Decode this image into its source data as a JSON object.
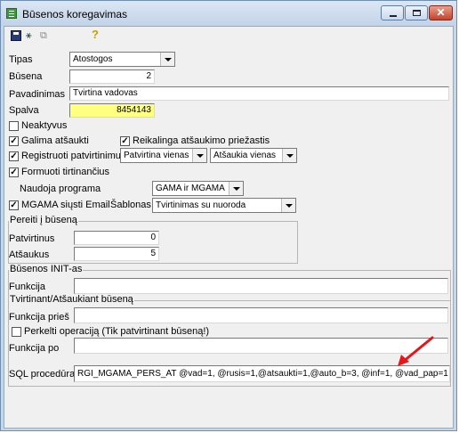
{
  "window": {
    "title": "Būsenos koregavimas",
    "app_icon": "form-icon",
    "accent": "#c7d6e8"
  },
  "toolbar": {
    "icons": [
      "save-icon",
      "tree-icon",
      "copy-icon",
      "help-icon"
    ],
    "tree_glyph": "⚹",
    "copy_glyph": "⧉",
    "help_glyph": "?"
  },
  "window_buttons": {
    "close_glyph": "✕"
  },
  "form": {
    "tipas": {
      "label": "Tipas",
      "value": "Atostogos"
    },
    "busena": {
      "label": "Būsena",
      "value": "2"
    },
    "pavadinimas": {
      "label": "Pavadinimas",
      "value": "Tvirtina vadovas"
    },
    "spalva": {
      "label": "Spalva",
      "value": "8454143",
      "color": "#ffff80"
    },
    "neaktyvus": {
      "label": "Neaktyvus",
      "checked": false
    },
    "galima_atsaukti": {
      "label": "Galima atšaukti",
      "checked": true
    },
    "reikalinga": {
      "label": "Reikalinga atšaukimo priežastis",
      "checked": true
    },
    "registruoti": {
      "label": "Registruoti patvirtinimus",
      "checked": true
    },
    "patvirtina": {
      "value": "Patvirtina vienas"
    },
    "atsaukia": {
      "value": "Atšaukia vienas"
    },
    "formuoti": {
      "label": "Formuoti tirtinančius",
      "checked": true
    },
    "naudoja": {
      "label": "Naudoja programa",
      "value": "GAMA ir MGAMA"
    },
    "mgama_email": {
      "label": "MGAMA siųsti Email",
      "checked": true
    },
    "sablonas": {
      "label": "Šablonas",
      "value": "Tvirtinimas su nuoroda"
    },
    "pereiti": {
      "title": "Pereiti į būseną",
      "patvirtinus": {
        "label": "Patvirtinus",
        "value": "0"
      },
      "atsaukus": {
        "label": "Atšaukus",
        "value": "5"
      }
    },
    "init": {
      "title": "Būsenos INIT-as",
      "funkcija": {
        "label": "Funkcija",
        "value": ""
      }
    },
    "tvirtinant": {
      "title": "Tvirtinant/Atšaukiant būseną",
      "funkcija_pries": {
        "label": "Funkcija prieš",
        "value": ""
      },
      "perkelti": {
        "label": "Perkelti operaciją (Tik patvirtinant būseną!)",
        "checked": false
      },
      "funkcija_po": {
        "label": "Funkcija po",
        "value": ""
      }
    },
    "sql": {
      "label": "SQL procedūra",
      "value": "RGI_MGAMA_PERS_AT @vad=1, @rusis=1,@atsaukti=1,@auto_b=3, @inf=1, @vad_pap=1"
    }
  },
  "annotation": {
    "color": "#e8151b"
  }
}
